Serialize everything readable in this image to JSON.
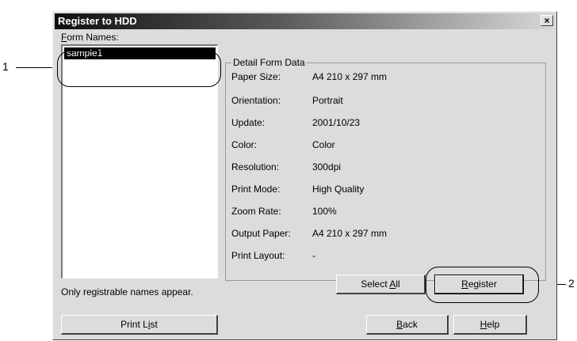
{
  "window": {
    "title": "Register to HDD",
    "close_symbol": "×"
  },
  "form_names": {
    "label_underlined": "F",
    "label_rest": "orm Names:",
    "items": [
      "sample1"
    ]
  },
  "detail": {
    "title": "Detail Form Data",
    "rows": [
      {
        "label": "Paper Size:",
        "value": "A4 210 x 297 mm"
      },
      {
        "label": "Orientation:",
        "value": "Portrait"
      },
      {
        "label": "Update:",
        "value": "2001/10/23"
      },
      {
        "label": "Color:",
        "value": "Color"
      },
      {
        "label": "Resolution:",
        "value": "300dpi"
      },
      {
        "label": "Print Mode:",
        "value": "High Quality"
      },
      {
        "label": "Zoom Rate:",
        "value": "100%"
      },
      {
        "label": "Output Paper:",
        "value": "A4 210 x 297 mm"
      },
      {
        "label": "Print Layout:",
        "value": "-"
      }
    ]
  },
  "note": "Only registrable names appear.",
  "buttons": {
    "print_list": {
      "pre": "Print L",
      "u": "i",
      "post": "st"
    },
    "select_all": {
      "pre": "Select ",
      "u": "A",
      "post": "ll"
    },
    "register": {
      "pre": "",
      "u": "R",
      "post": "egister"
    },
    "back": {
      "pre": "",
      "u": "B",
      "post": "ack"
    },
    "help": {
      "pre": "",
      "u": "H",
      "post": "elp"
    }
  },
  "callouts": {
    "one": "1",
    "two": "2"
  }
}
